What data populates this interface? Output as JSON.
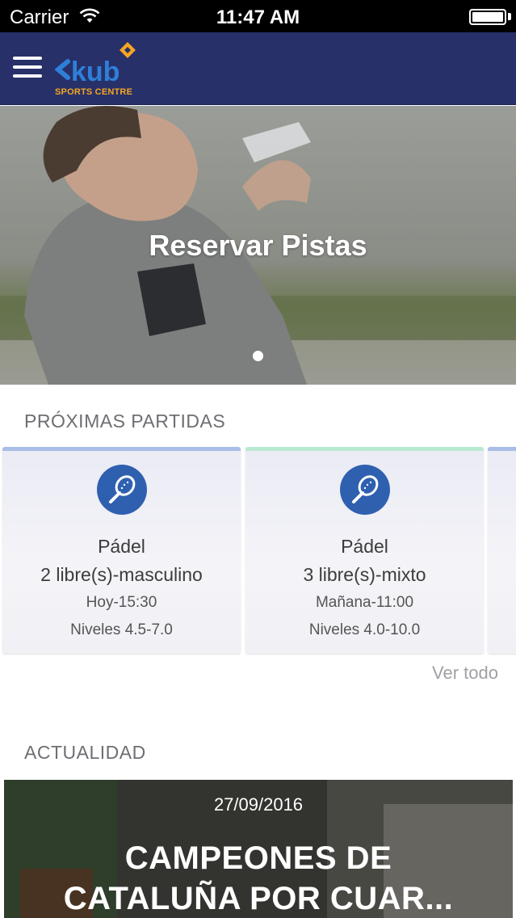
{
  "status_bar": {
    "carrier": "Carrier",
    "time": "11:47 AM"
  },
  "navbar": {
    "logo_text": "kub",
    "logo_subtitle": "SPORTS CENTRE"
  },
  "hero": {
    "title": "Reservar Pistas"
  },
  "upcoming": {
    "section_title": "PRÓXIMAS PARTIDAS",
    "see_all": "Ver todo",
    "cards": [
      {
        "sport": "Pádel",
        "free": "2 libre(s)-masculino",
        "time": "Hoy-15:30",
        "levels": "Niveles 4.5-7.0",
        "accent": "#a9bde8",
        "icon": "padel-racket-icon"
      },
      {
        "sport": "Pádel",
        "free": "3 libre(s)-mixto",
        "time": "Mañana-11:00",
        "levels": "Niveles 4.0-10.0",
        "accent": "#b9ead2",
        "icon": "padel-racket-icon"
      }
    ]
  },
  "news": {
    "section_title": "ACTUALIDAD",
    "date": "27/09/2016",
    "title_line1": "CAMPEONES DE",
    "title_line2": "CATALUÑA POR CUAR..."
  },
  "colors": {
    "navbar": "#273069",
    "icon_circle": "#2f60b0",
    "logo_orange": "#f5a623",
    "logo_blue": "#2f7fd8"
  }
}
